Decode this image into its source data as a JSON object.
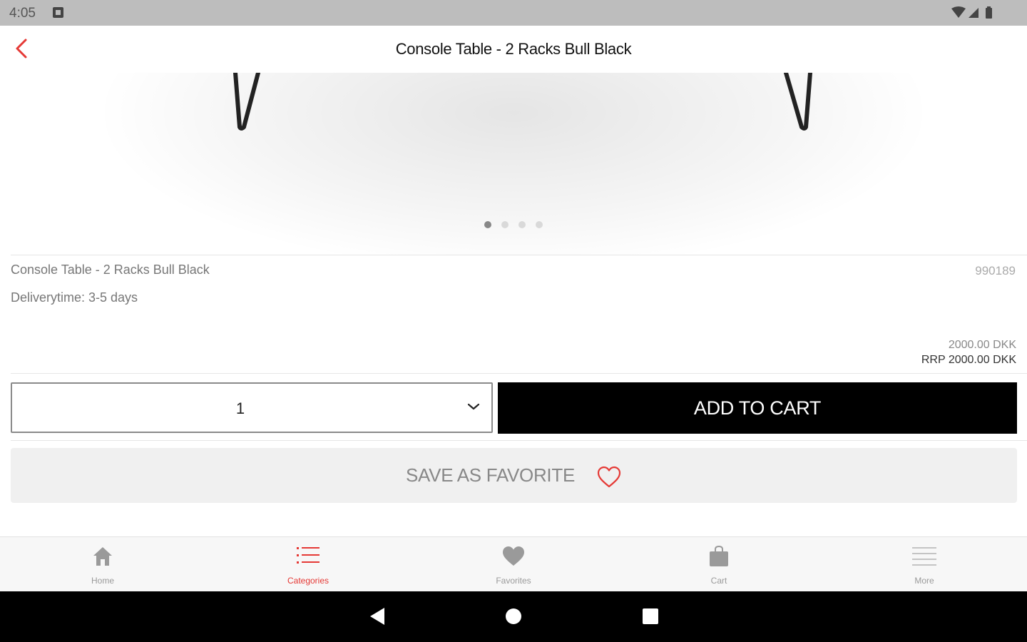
{
  "status_bar": {
    "time": "4:05"
  },
  "header": {
    "title": "Console Table - 2 Racks Bull Black"
  },
  "carousel": {
    "count": 4,
    "active_index": 0
  },
  "product": {
    "name": "Console Table - 2 Racks Bull Black",
    "sku": "990189",
    "delivery": "Deliverytime: 3-5 days",
    "price": "2000.00 DKK",
    "rrp": "RRP 2000.00 DKK"
  },
  "actions": {
    "quantity": "1",
    "add_to_cart": "ADD TO CART",
    "save_favorite": "SAVE AS FAVORITE"
  },
  "bottom_nav": {
    "items": [
      {
        "label": "Home",
        "icon": "home-icon"
      },
      {
        "label": "Categories",
        "icon": "list-icon",
        "active": true
      },
      {
        "label": "Favorites",
        "icon": "heart-icon"
      },
      {
        "label": "Cart",
        "icon": "bag-icon"
      },
      {
        "label": "More",
        "icon": "menu-icon"
      }
    ]
  },
  "colors": {
    "accent": "#e53935",
    "primary_button": "#000000",
    "favorite_button": "#f0f0f0",
    "status_bar": "#bdbdbd"
  }
}
